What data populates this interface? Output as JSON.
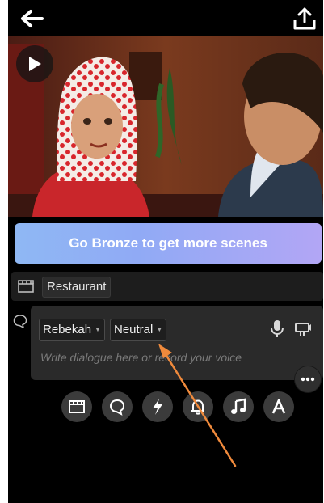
{
  "promo": {
    "label": "Go Bronze to get more scenes"
  },
  "scene": {
    "name": "Restaurant"
  },
  "dialogue": {
    "character": "Rebekah",
    "emotion": "Neutral",
    "placeholder": "Write dialogue here or record your voice"
  },
  "icons": {
    "back": "arrow-left",
    "export": "share-upload",
    "play": "play",
    "scene": "clapperboard",
    "bubble": "speech-bubble",
    "mic": "microphone",
    "camera": "camera",
    "more": "more-horizontal",
    "toolbar": [
      "clapperboard",
      "speech-bubble",
      "lightning",
      "bell",
      "music-note",
      "letter-a"
    ]
  },
  "colors": {
    "promo_start": "#8fb8f4",
    "promo_end": "#b2a6f5",
    "arrow": "#f08a3c"
  }
}
